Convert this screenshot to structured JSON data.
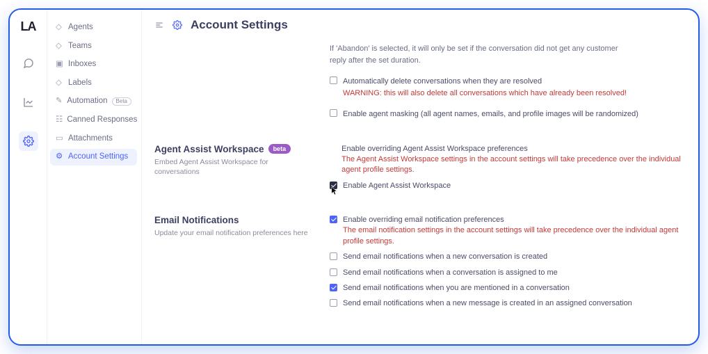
{
  "logo": "LA",
  "sidebar": {
    "items": [
      {
        "icon": "agents",
        "label": "Agents"
      },
      {
        "icon": "teams",
        "label": "Teams"
      },
      {
        "icon": "inbox",
        "label": "Inboxes"
      },
      {
        "icon": "label",
        "label": "Labels"
      },
      {
        "icon": "automation",
        "label": "Automation",
        "badge": "Beta"
      },
      {
        "icon": "snippet",
        "label": "Canned Responses"
      },
      {
        "icon": "folder",
        "label": "Attachments"
      },
      {
        "icon": "gear",
        "label": "Account Settings"
      }
    ]
  },
  "header": {
    "title": "Account Settings"
  },
  "partial": {
    "line1": "If 'Abandon' is selected, it will only be set if the conversation did not get any customer",
    "line2": "reply after the set duration."
  },
  "top_options": [
    {
      "text": "Automatically delete conversations when they are resolved",
      "warn": "WARNING: this will also delete all conversations which have already been resolved!",
      "checked": false
    },
    {
      "text": "Enable agent masking (all agent names, emails, and profile images will be randomized)",
      "checked": false
    }
  ],
  "sections": [
    {
      "title": "Agent Assist Workspace",
      "badge": "beta",
      "subtitle": "Embed Agent Assist Workspace for conversations",
      "options": [
        {
          "text": "Enable overriding Agent Assist Workspace preferences",
          "warn": "The Agent Assist Workspace settings in the account settings will take precedence over the individual agent profile settings.",
          "checked": false,
          "checkbox": false
        },
        {
          "text": "Enable Agent Assist Workspace",
          "checked": true,
          "dark": true
        }
      ]
    },
    {
      "title": "Email Notifications",
      "subtitle": "Update your email notification preferences here",
      "options": [
        {
          "text": "Enable overriding email notification preferences",
          "warn": "The email notification settings in the account settings will take precedence over the individual agent profile settings.",
          "checked": true
        },
        {
          "text": "Send email notifications when a new conversation is created",
          "checked": false
        },
        {
          "text": "Send email notifications when a conversation is assigned to me",
          "checked": false
        },
        {
          "text": "Send email notifications when you are mentioned in a conversation",
          "checked": true
        },
        {
          "text": "Send email notifications when a new message is created in an assigned conversation",
          "checked": false
        }
      ]
    }
  ]
}
